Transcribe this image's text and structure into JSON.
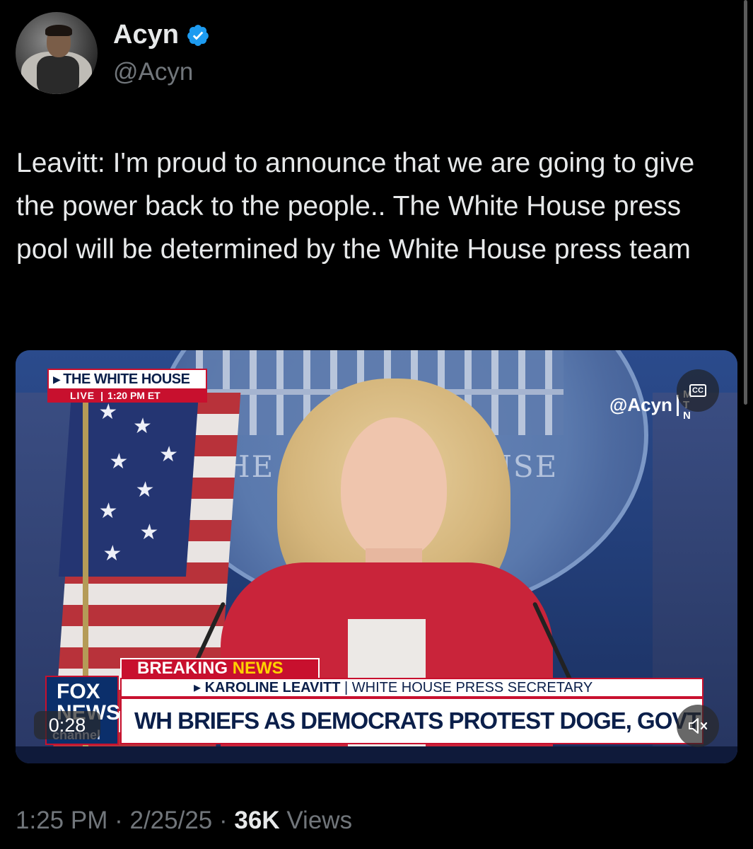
{
  "author": {
    "name": "Acyn",
    "handle": "@Acyn",
    "verified_icon": "verified-badge-icon",
    "verified_color": "#1d9bf0"
  },
  "tweet": {
    "text": "Leavitt: I'm proud to announce that we are going to give the power back to the people.. The White House press pool will be determined by the White House press team"
  },
  "video": {
    "badge_title": "THE WHITE HOUSE",
    "badge_live": "LIVE",
    "badge_time": "1:20 PM ET",
    "watermark_handle": "@Acyn",
    "watermark_mtn": [
      "M",
      "T",
      "N"
    ],
    "seal_text_left": "THE W",
    "seal_text_right": "OUSE",
    "breaking_label": "BREAKING",
    "breaking_news": "NEWS",
    "name_line_name": "KAROLINE LEAVITT",
    "name_line_title": "WHITE HOUSE PRESS SECRETARY",
    "headline": "WH BRIEFS AS DEMOCRATS PROTEST DOGE, GOVT CUTS",
    "network_logo": [
      "FOX",
      "NEWS",
      "channel"
    ],
    "elapsed": "0:28",
    "cc_label": "CC",
    "accent_red": "#c8102e",
    "accent_navy": "#0b1f4a"
  },
  "meta": {
    "time": "1:25 PM",
    "date": "2/25/25",
    "views_count": "36K",
    "views_label": "Views"
  }
}
